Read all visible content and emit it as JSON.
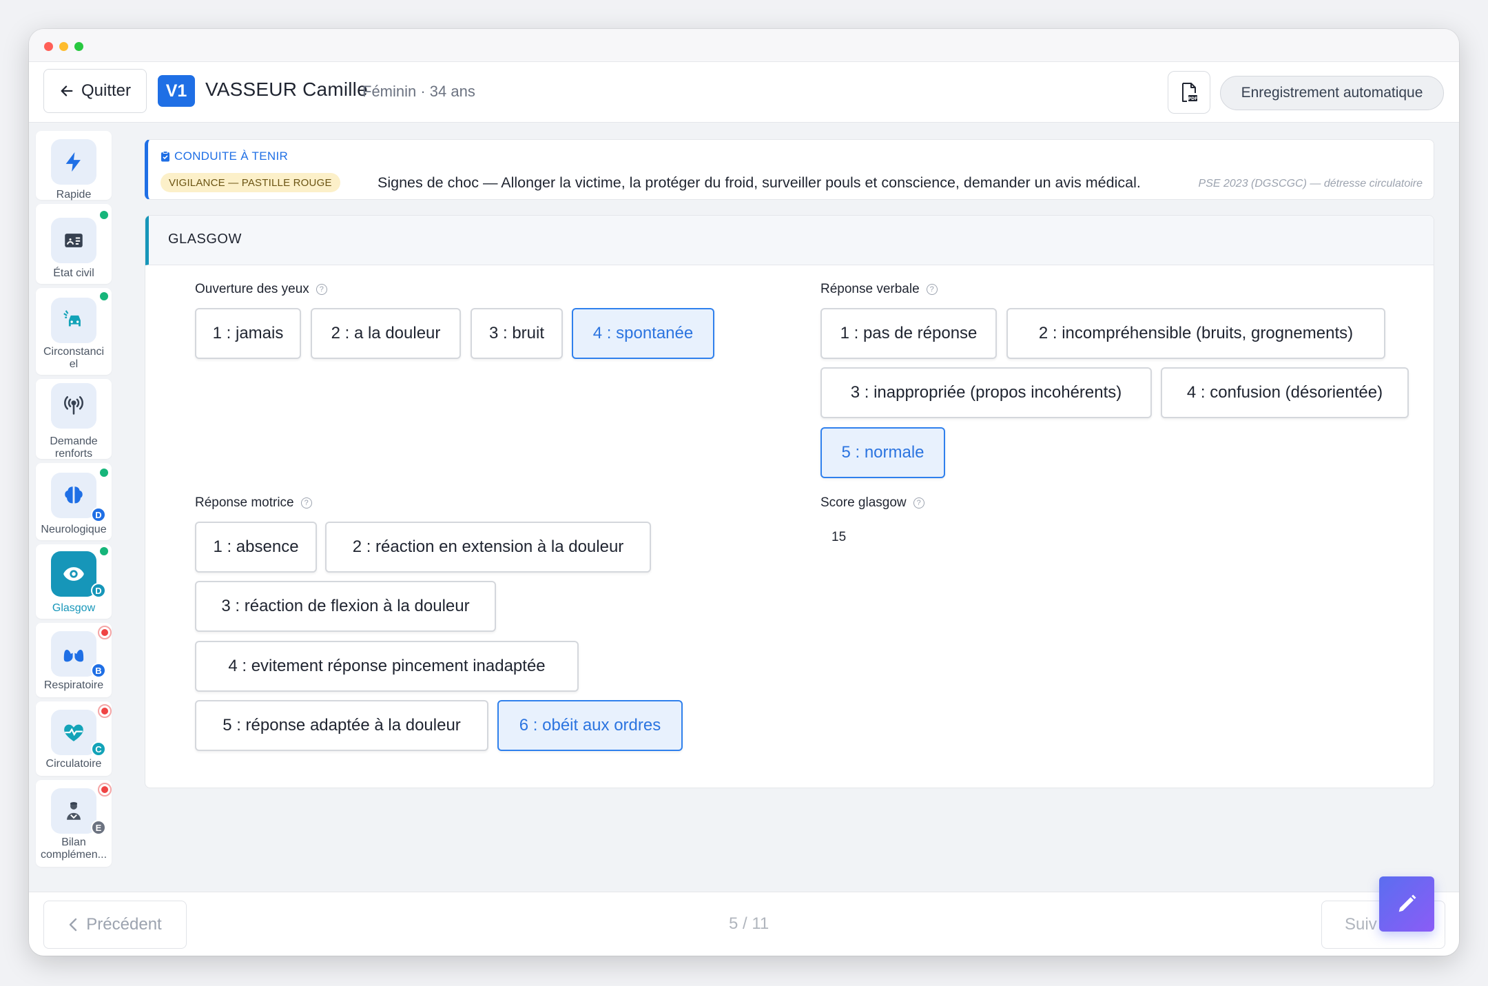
{
  "header": {
    "quit_label": "Quitter",
    "victim_badge": "V1",
    "victim_name": "VASSEUR Camille",
    "victim_info": "Féminin · 34 ans",
    "autosave_label": "Enregistrement automatique"
  },
  "sidebar": {
    "items": [
      {
        "label": "Rapide",
        "icon": "lightning-icon",
        "status": "none"
      },
      {
        "label": "État civil",
        "icon": "id-card-icon",
        "status": "ok"
      },
      {
        "label": "Circonstanciel",
        "icon": "car-crash-icon",
        "status": "ok"
      },
      {
        "label": "Demande renforts",
        "icon": "antenna-icon",
        "status": "none"
      },
      {
        "label": "Neurologique",
        "icon": "brain-icon",
        "status": "ok",
        "badge": "D"
      },
      {
        "label": "Glasgow",
        "icon": "eye-icon",
        "status": "ok",
        "badge": "D",
        "active": true
      },
      {
        "label": "Respiratoire",
        "icon": "lungs-icon",
        "status": "alert",
        "badge": "B"
      },
      {
        "label": "Circulatoire",
        "icon": "heart-pulse-icon",
        "status": "alert",
        "badge": "C"
      },
      {
        "label": "Bilan complémen...",
        "icon": "medic-icon",
        "status": "alert",
        "badge": "E"
      }
    ],
    "labels_display": {
      "circonstanciel_l1": "Circonstanci",
      "circonstanciel_l2": "el",
      "renforts_l1": "Demande",
      "renforts_l2": "renforts",
      "bilan_l1": "Bilan",
      "bilan_l2": "complémen..."
    }
  },
  "conduct": {
    "title": "CONDUITE À TENIR",
    "badge": "VIGILANCE — PASTILLE ROUGE",
    "text": "Signes de choc — Allonger la victime, la protéger du froid, surveiller pouls et conscience, demander un avis médical.",
    "reference": "PSE 2023 (DGSCGC) — détresse circulatoire"
  },
  "glasgow": {
    "title": "GLASGOW",
    "eyes": {
      "label": "Ouverture des yeux",
      "options": [
        "1 : jamais",
        "2 : a la douleur",
        "3 : bruit",
        "4 : spontanée"
      ],
      "selected": "4 : spontanée"
    },
    "verbal": {
      "label": "Réponse verbale",
      "options": [
        "1 : pas de réponse",
        "2 : incompréhensible (bruits, grognements)",
        "3 : inappropriée (propos incohérents)",
        "4 : confusion (désorientée)",
        "5 : normale"
      ],
      "selected": "5 : normale"
    },
    "motor": {
      "label": "Réponse motrice",
      "options": [
        "1 : absence",
        "2 : réaction en extension à la douleur",
        "3 : réaction de flexion à la douleur",
        "4 : evitement réponse pincement inadaptée",
        "5 : réponse adaptée à la douleur",
        "6 : obéit aux ordres"
      ],
      "selected": "6 : obéit aux ordres"
    },
    "score": {
      "label": "Score glasgow",
      "value": "15"
    }
  },
  "footer": {
    "prev_label": "Précédent",
    "page_indicator": "5 / 11",
    "next_label": "Suiv"
  },
  "colors": {
    "accent": "#1f6fe5",
    "teal": "#1696b9",
    "selected_bg": "#e8f1fd",
    "ok_status": "#16b57a",
    "alert_status": "#ef4444"
  }
}
